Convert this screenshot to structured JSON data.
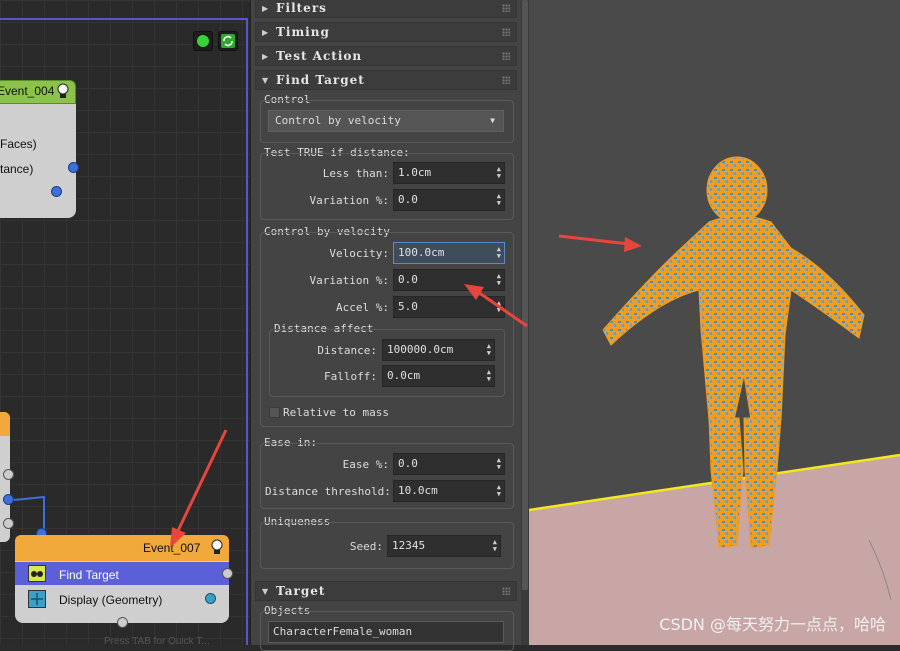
{
  "graph": {
    "event_004": {
      "title": "Event_004",
      "row1": "Faces)",
      "row2": "tance)"
    },
    "event_007": {
      "title": "Event_007",
      "op1": "Find Target",
      "op2": "Display (Geometry)"
    },
    "footer_hint": "Press TAB for Quick T..."
  },
  "panel": {
    "rollouts": {
      "filters": "Filters",
      "timing": "Timing",
      "test_action": "Test Action",
      "find_target": "Find Target",
      "target": "Target"
    },
    "control": {
      "label": "Control",
      "value": "Control by velocity"
    },
    "test_true": {
      "label": "Test TRUE if distance:",
      "less_than_label": "Less than:",
      "less_than_value": "1.0cm",
      "variation_label": "Variation %:",
      "variation_value": "0.0"
    },
    "control_by_velocity": {
      "label": "Control by velocity",
      "velocity_label": "Velocity:",
      "velocity_value": "100.0cm",
      "variation_label": "Variation %:",
      "variation_value": "0.0",
      "accel_label": "Accel %:",
      "accel_value": "5.0",
      "distance_affect": {
        "label": "Distance affect",
        "distance_label": "Distance:",
        "distance_value": "100000.0cm",
        "falloff_label": "Falloff:",
        "falloff_value": "0.0cm"
      },
      "relative_to_mass": "Relative to mass"
    },
    "ease_in": {
      "label": "Ease in:",
      "ease_label": "Ease %:",
      "ease_value": "0.0",
      "threshold_label": "Distance threshold:",
      "threshold_value": "10.0cm"
    },
    "uniqueness": {
      "label": "Uniqueness",
      "seed_label": "Seed:",
      "seed_value": "12345"
    },
    "target": {
      "objects_label": "Objects",
      "objects_value": "CharacterFemale_woman"
    }
  },
  "viewport": {
    "watermark": "CSDN @每天努力一点点，哈哈"
  },
  "colors": {
    "accent_red": "#e8453c",
    "node_orange": "#f2a93b",
    "node_green": "#8bc34a",
    "selection_blue": "#5558c8",
    "particle_orange": "#f39c1e",
    "particle_blue": "#4a8fb0"
  }
}
